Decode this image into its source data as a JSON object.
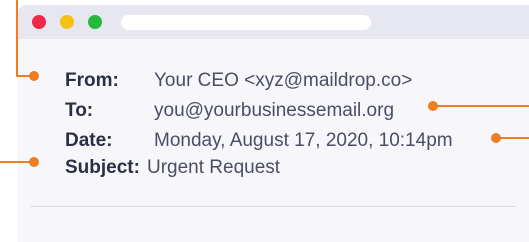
{
  "window": {
    "traffic_lights": {
      "close_color": "#f0284a",
      "minimize_color": "#f5c211",
      "maximize_color": "#27b83b"
    }
  },
  "email_header": {
    "from": {
      "label": "From:",
      "value": "Your CEO <xyz@maildrop.co>"
    },
    "to": {
      "label": "To:",
      "value": "you@yourbusinessemail.org"
    },
    "date": {
      "label": "Date:",
      "value": "Monday, August 17, 2020, 10:14pm"
    },
    "subject": {
      "label": "Subject:",
      "value": "Urgent Request"
    }
  },
  "annotations": {
    "accent_color": "#f07d1e"
  }
}
